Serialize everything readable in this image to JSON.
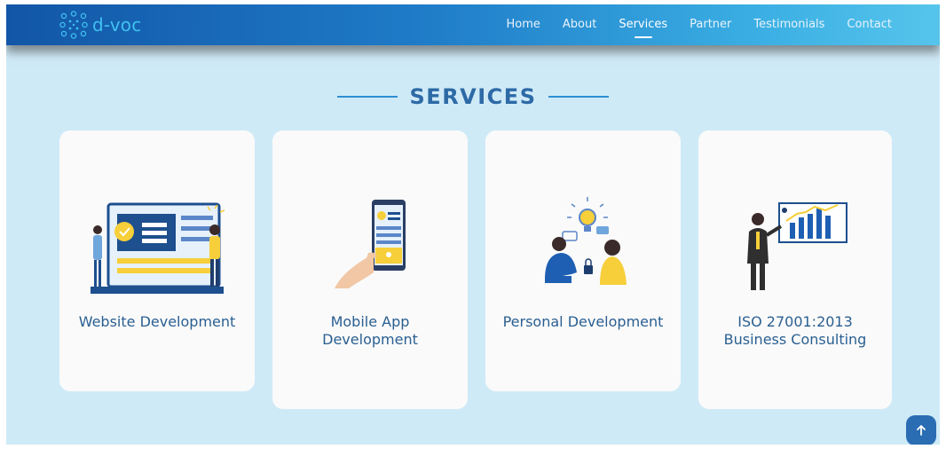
{
  "brand": {
    "name": "d-voc",
    "accent": "#3fc0f0"
  },
  "nav": {
    "items": [
      {
        "label": "Home"
      },
      {
        "label": "About"
      },
      {
        "label": "Services",
        "active": true
      },
      {
        "label": "Partner"
      },
      {
        "label": "Testimonials"
      },
      {
        "label": "Contact"
      }
    ]
  },
  "section": {
    "title": "SERVICES"
  },
  "services": [
    {
      "title": "Website Development",
      "icon": "website-development-illustration"
    },
    {
      "title": "Mobile App Development",
      "icon": "mobile-app-illustration"
    },
    {
      "title": "Personal Development",
      "icon": "personal-development-illustration"
    },
    {
      "title": "ISO 27001:2013 Business Consulting",
      "icon": "business-consulting-illustration"
    }
  ],
  "scroll_top": {
    "icon": "arrow-up-icon"
  },
  "colors": {
    "nav_start": "#1256a7",
    "nav_end": "#56c5ec",
    "background": "#cfeaf7",
    "card": "#fafafa",
    "heading": "#2d6aa6",
    "card_text": "#2a5f91",
    "button": "#2a6db3"
  }
}
